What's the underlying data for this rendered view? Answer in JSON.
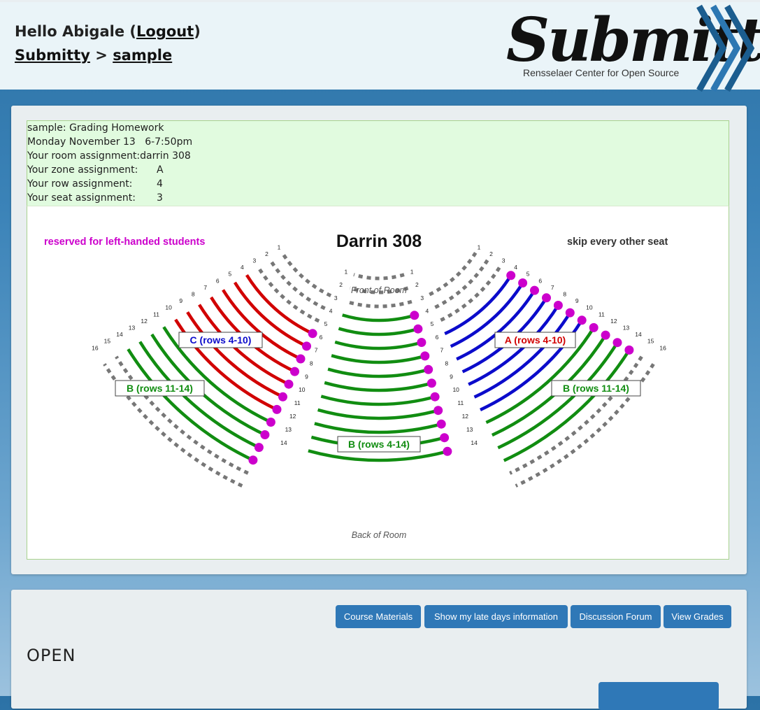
{
  "header": {
    "greeting": "Hello Abigale",
    "logout": "Logout",
    "breadcrumb_root": "Submitty",
    "breadcrumb_sep": ">",
    "breadcrumb_course": "sample",
    "logo_text": "Submitty",
    "logo_subtitle": "Rensselaer Center for Open Source"
  },
  "exam": {
    "title": "sample: Grading Homework",
    "date": "Monday November 13",
    "time": "6-7:50pm",
    "room_label": "Your room assignment:",
    "room": "darrin 308",
    "zone_label": "Your zone assignment:",
    "zone": "A",
    "row_label": "Your row assignment:",
    "row": "4",
    "seat_label": "Your seat assignment:",
    "seat": "3"
  },
  "seating_map": {
    "room_title": "Darrin 308",
    "left_note": "reserved for left-handed students",
    "right_note": "skip every other seat",
    "front": "Front of Room",
    "back": "Back of Room",
    "zone_c": "C (rows 4-10)",
    "zone_b_left": "B (rows 11-14)",
    "zone_b_center": "B (rows 4-14)",
    "zone_a": "A (rows 4-10)",
    "zone_b_right": "B (rows 11-14)",
    "colors": {
      "zone_a": "#d10000",
      "zone_b": "#118d11",
      "zone_c": "#0b0bcb",
      "reserved": "#cc00cc",
      "unused": "#777777",
      "note": "#cc00cc"
    },
    "row_numbers": [
      "1",
      "2",
      "3",
      "4",
      "5",
      "6",
      "7",
      "8",
      "9",
      "10",
      "11",
      "12",
      "13",
      "14",
      "15",
      "16"
    ],
    "center_row_numbers": [
      "1",
      "2",
      "3",
      "4",
      "5",
      "6",
      "7",
      "8",
      "9",
      "10",
      "11",
      "12",
      "13",
      "14"
    ]
  },
  "nav": {
    "course_materials": "Course Materials",
    "late_days": "Show my late days information",
    "forum": "Discussion Forum",
    "grades": "View Grades"
  },
  "section_title": "OPEN"
}
